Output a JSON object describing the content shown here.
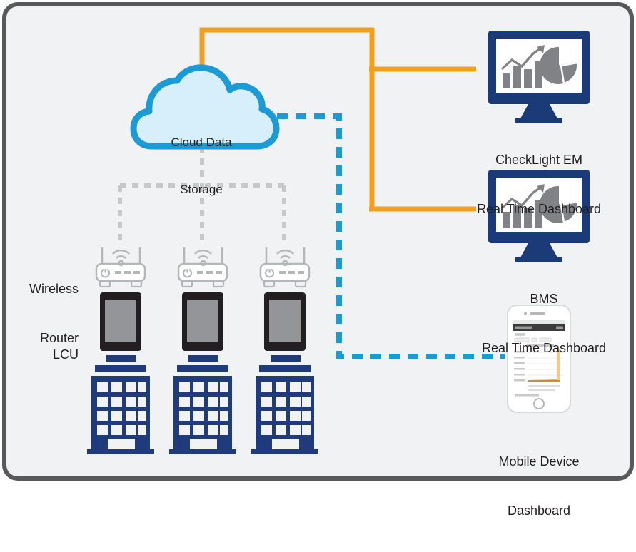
{
  "diagram": {
    "title": "Cloud Data Storage System Architecture",
    "background_color": "#f1f2f3",
    "frame_color": "#58595b"
  },
  "colors": {
    "cloud_fill": "#d7eefb",
    "cloud_stroke": "#1b9ad6",
    "orange_link": "#f0a01e",
    "cyan_link": "#1b9ad6",
    "gray_link": "#c6c8ca",
    "navy": "#1b3a78",
    "building_navy": "#1f3b7b",
    "device_dark": "#231f20",
    "device_screen": "#939598",
    "router_stroke": "#b4b6b8",
    "text": "#231f20"
  },
  "nodes": {
    "cloud": {
      "name": "Cloud Data Storage",
      "line1": "Cloud Data",
      "line2": "Storage"
    },
    "wireless_router": {
      "line1": "Wireless",
      "line2": "Router",
      "count": 3
    },
    "lcu": {
      "line1": "LCU",
      "count": 3
    },
    "buildings": {
      "count": 3,
      "window_rows": 5,
      "window_cols": 4
    },
    "checklight": {
      "line1": "CheckLight EM",
      "line2": "Real Time Dashboard"
    },
    "bms": {
      "line1": "BMS",
      "line2": "Real Time Dashboard"
    },
    "mobile": {
      "line1": "Mobile Device",
      "line2": "Dashboard"
    }
  },
  "connections": [
    {
      "from": "cloud",
      "to": "checklight",
      "style": "solid",
      "color": "#f0a01e"
    },
    {
      "from": "cloud",
      "to": "bms",
      "style": "solid",
      "color": "#f0a01e"
    },
    {
      "from": "cloud",
      "to": "mobile",
      "style": "dashed",
      "color": "#1b9ad6"
    },
    {
      "from": "cloud",
      "to": "wireless_router",
      "style": "dashed",
      "color": "#c6c8ca"
    }
  ]
}
